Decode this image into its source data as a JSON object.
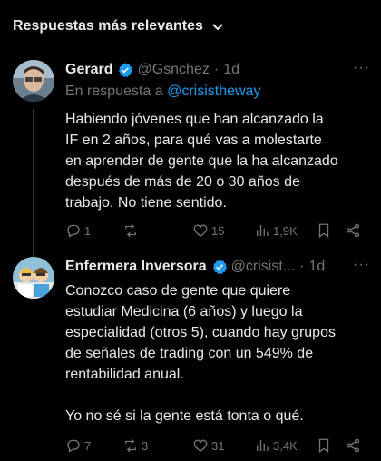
{
  "header": {
    "title": "Respuestas más relevantes"
  },
  "tweets": [
    {
      "name": "Gerard",
      "handle": "@Gsnchez",
      "dot": "·",
      "time": "1d",
      "reply_prefix": "En respuesta a",
      "reply_mention": "@crisistheway",
      "text": "Habiendo jóvenes que han alcanzado la\nIF en 2 años, para qué vas a molestarte\nen aprender de gente que la ha alcanzado\ndespués de más de 20 o 30 años de\ntrabajo. No tiene sentido.",
      "replies": "1",
      "retweets": "",
      "likes": "15",
      "views": "1,9K"
    },
    {
      "name": "Enfermera Inversora",
      "handle": "@crisist...",
      "dot": "·",
      "time": "1d",
      "text": "Conozco caso de gente que quiere\nestudiar Medicina (6 años) y luego la\nespecialidad (otros 5), cuando hay grupos\nde señales de trading con un 549% de\nrentabilidad anual.\n\nYo no sé si la gente está tonta o qué.",
      "replies": "7",
      "retweets": "3",
      "likes": "31",
      "views": "3,4K"
    }
  ],
  "colors": {
    "accent": "#1d9bf0",
    "muted": "#71767b",
    "text": "#e7e9ea",
    "background": "#000000"
  }
}
